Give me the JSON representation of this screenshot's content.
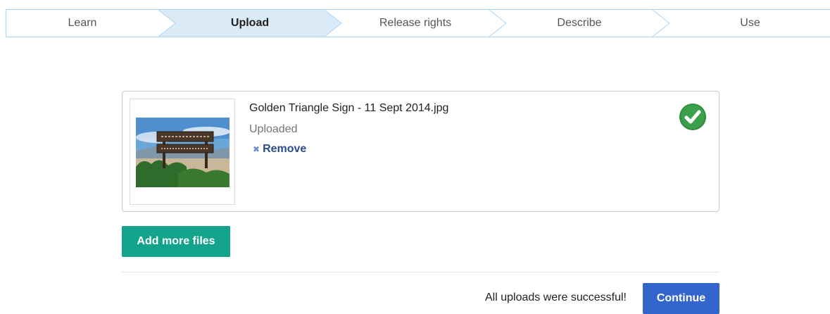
{
  "steps": [
    {
      "label": "Learn",
      "active": false
    },
    {
      "label": "Upload",
      "active": true
    },
    {
      "label": "Release rights",
      "active": false
    },
    {
      "label": "Describe",
      "active": false
    },
    {
      "label": "Use",
      "active": false
    }
  ],
  "file": {
    "name": "Golden Triangle Sign - 11 Sept 2014.jpg",
    "status": "Uploaded",
    "remove_label": "Remove",
    "status_icon": "check-circle-icon"
  },
  "actions": {
    "add_more_label": "Add more files",
    "success_message": "All uploads were successful!",
    "continue_label": "Continue"
  },
  "colors": {
    "tracker_border": "#a7d7f9",
    "active_step_bg": "#dbeaf7",
    "add_button": "#14a38b",
    "continue_button": "#3366cc",
    "link": "#2a4b8d",
    "check": "#2e8b3f"
  }
}
